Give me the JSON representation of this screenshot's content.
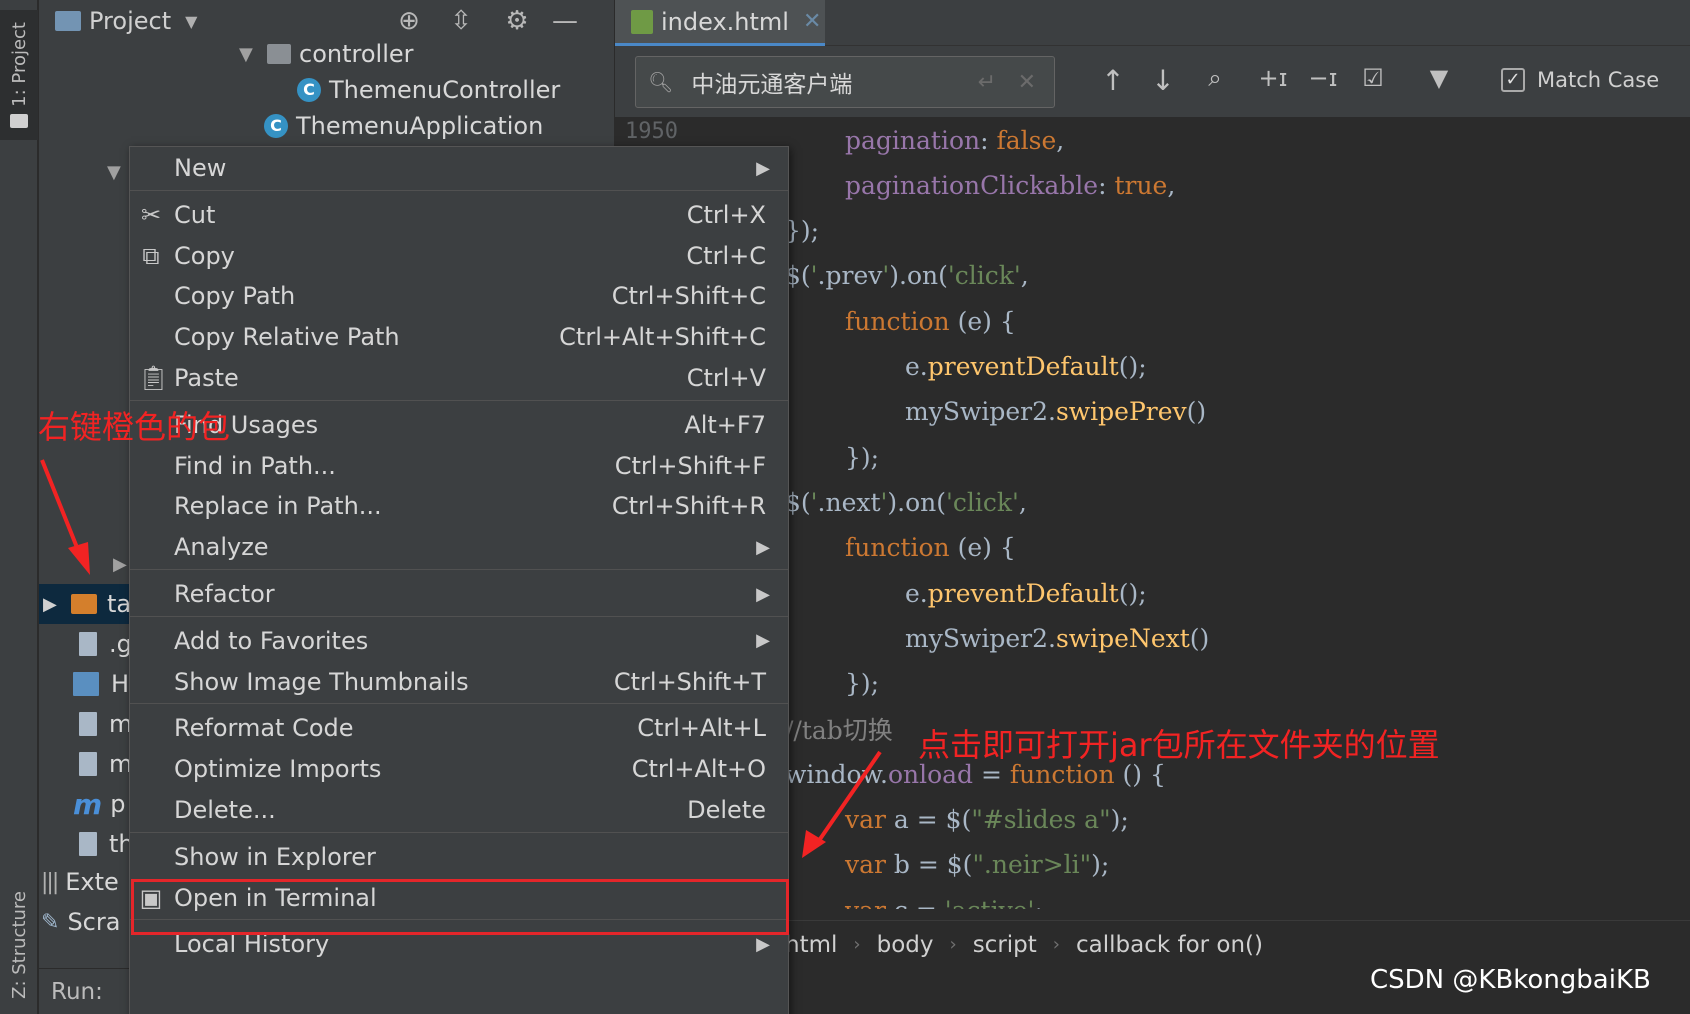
{
  "left_strip": {
    "project_tab": "1: Project",
    "structure_tab": "Z: Structure"
  },
  "project_panel": {
    "title": "Project",
    "tree": {
      "controller": "controller",
      "themenu_controller": "ThemenuController",
      "themenu_application": "ThemenuApplication",
      "selected_folder_fragment": "ta",
      "file_fragments": [
        ".g",
        "H",
        "m",
        "m",
        "p",
        "th"
      ],
      "external_libraries_fragment": "Exte",
      "scratches_fragment": "Scra"
    },
    "icon_names": [
      "locate-icon",
      "collapse-icon",
      "gear-icon",
      "minimize-icon"
    ]
  },
  "run_bar": {
    "label": "Run:"
  },
  "editor": {
    "tab_label": "index.html",
    "find": {
      "query": "中油元通客户端",
      "match_case_label": "Match Case",
      "match_case_checked": true
    },
    "gutter_number": "1950",
    "code_lines": [
      {
        "indent": 2,
        "parts": [
          [
            "t-prop",
            "pagination"
          ],
          [
            "t-plain",
            ": "
          ],
          [
            "t-kw",
            "false"
          ],
          [
            "t-plain",
            ","
          ]
        ]
      },
      {
        "indent": 2,
        "parts": [
          [
            "t-prop",
            "paginationClickable"
          ],
          [
            "t-plain",
            ": "
          ],
          [
            "t-kw",
            "true"
          ],
          [
            "t-plain",
            ","
          ]
        ]
      },
      {
        "indent": 0,
        "parts": [
          [
            "t-plain",
            "});"
          ]
        ]
      },
      {
        "indent": 0,
        "parts": [
          [
            "t-plain",
            "$("
          ],
          [
            "t-str",
            "'"
          ],
          [
            "t-plain",
            ".prev"
          ],
          [
            "t-str",
            "'"
          ],
          [
            "t-plain",
            ").on("
          ],
          [
            "t-str",
            "'click'"
          ],
          [
            "t-plain",
            ","
          ]
        ]
      },
      {
        "indent": 2,
        "parts": [
          [
            "t-kw",
            "function"
          ],
          [
            "t-plain",
            " (e) {"
          ]
        ]
      },
      {
        "indent": 4,
        "parts": [
          [
            "t-plain",
            "e."
          ],
          [
            "t-fn",
            "preventDefault"
          ],
          [
            "t-plain",
            "();"
          ]
        ]
      },
      {
        "indent": 4,
        "parts": [
          [
            "t-plain",
            "mySwiper2."
          ],
          [
            "t-fn",
            "swipePrev"
          ],
          [
            "t-plain",
            "()"
          ]
        ]
      },
      {
        "indent": 2,
        "parts": [
          [
            "t-plain",
            "});"
          ]
        ]
      },
      {
        "indent": 0,
        "parts": [
          [
            "t-plain",
            "$("
          ],
          [
            "t-str",
            "'"
          ],
          [
            "t-plain",
            ".next"
          ],
          [
            "t-str",
            "'"
          ],
          [
            "t-plain",
            ").on("
          ],
          [
            "t-str",
            "'click'"
          ],
          [
            "t-plain",
            ","
          ]
        ]
      },
      {
        "indent": 2,
        "parts": [
          [
            "t-kw",
            "function"
          ],
          [
            "t-plain",
            " (e) {"
          ]
        ]
      },
      {
        "indent": 4,
        "parts": [
          [
            "t-plain",
            "e."
          ],
          [
            "t-fn",
            "preventDefault"
          ],
          [
            "t-plain",
            "();"
          ]
        ]
      },
      {
        "indent": 4,
        "parts": [
          [
            "t-plain",
            "mySwiper2."
          ],
          [
            "t-fn",
            "swipeNext"
          ],
          [
            "t-plain",
            "()"
          ]
        ]
      },
      {
        "indent": 2,
        "parts": [
          [
            "t-plain",
            "});"
          ]
        ]
      },
      {
        "indent": 0,
        "parts": [
          [
            "t-cmt",
            "//tab切换"
          ]
        ]
      },
      {
        "indent": 0,
        "parts": [
          [
            "t-plain",
            "window."
          ],
          [
            "t-prop",
            "onload"
          ],
          [
            "t-plain",
            " = "
          ],
          [
            "t-kw",
            "function"
          ],
          [
            "t-plain",
            " () {"
          ]
        ]
      },
      {
        "indent": 2,
        "parts": [
          [
            "t-kw",
            "var"
          ],
          [
            "t-plain",
            " a = $("
          ],
          [
            "t-str",
            "\"#slides a\""
          ],
          [
            "t-plain",
            ");"
          ]
        ]
      },
      {
        "indent": 2,
        "parts": [
          [
            "t-kw",
            "var"
          ],
          [
            "t-plain",
            " b = $("
          ],
          [
            "t-str",
            "\".neir>li\""
          ],
          [
            "t-plain",
            ");"
          ]
        ]
      },
      {
        "indent": 2,
        "parts": [
          [
            "t-kw",
            "var"
          ],
          [
            "t-plain",
            " c = "
          ],
          [
            "t-str",
            "'active'"
          ],
          [
            "t-plain",
            ";"
          ]
        ]
      }
    ],
    "breadcrumb": [
      "html",
      "body",
      "script",
      "callback for on()"
    ]
  },
  "context_menu": {
    "items": [
      {
        "label": "New",
        "shortcut": "",
        "submenu": true,
        "icon": ""
      },
      {
        "label": "Cut",
        "shortcut": "Ctrl+X",
        "submenu": false,
        "icon": "scissors-icon",
        "sep_before": true
      },
      {
        "label": "Copy",
        "shortcut": "Ctrl+C",
        "submenu": false,
        "icon": "copy-icon"
      },
      {
        "label": "Copy Path",
        "shortcut": "Ctrl+Shift+C",
        "submenu": false,
        "icon": ""
      },
      {
        "label": "Copy Relative Path",
        "shortcut": "Ctrl+Alt+Shift+C",
        "submenu": false,
        "icon": ""
      },
      {
        "label": "Paste",
        "shortcut": "Ctrl+V",
        "submenu": false,
        "icon": "paste-icon"
      },
      {
        "label": "Find Usages",
        "shortcut": "Alt+F7",
        "submenu": false,
        "icon": "",
        "sep_before": true
      },
      {
        "label": "Find in Path...",
        "shortcut": "Ctrl+Shift+F",
        "submenu": false,
        "icon": ""
      },
      {
        "label": "Replace in Path...",
        "shortcut": "Ctrl+Shift+R",
        "submenu": false,
        "icon": ""
      },
      {
        "label": "Analyze",
        "shortcut": "",
        "submenu": true,
        "icon": ""
      },
      {
        "label": "Refactor",
        "shortcut": "",
        "submenu": true,
        "icon": "",
        "sep_before": true
      },
      {
        "label": "Add to Favorites",
        "shortcut": "",
        "submenu": true,
        "icon": "",
        "sep_before": true
      },
      {
        "label": "Show Image Thumbnails",
        "shortcut": "Ctrl+Shift+T",
        "submenu": false,
        "icon": ""
      },
      {
        "label": "Reformat Code",
        "shortcut": "Ctrl+Alt+L",
        "submenu": false,
        "icon": "",
        "sep_before": true
      },
      {
        "label": "Optimize Imports",
        "shortcut": "Ctrl+Alt+O",
        "submenu": false,
        "icon": ""
      },
      {
        "label": "Delete...",
        "shortcut": "Delete",
        "submenu": false,
        "icon": ""
      },
      {
        "label": "Show in Explorer",
        "shortcut": "",
        "submenu": false,
        "icon": "",
        "sep_before": true,
        "highlighted": true
      },
      {
        "label": "Open in Terminal",
        "shortcut": "",
        "submenu": false,
        "icon": "terminal-icon"
      },
      {
        "label": "Local History",
        "shortcut": "",
        "submenu": true,
        "icon": "",
        "sep_before": true
      }
    ]
  },
  "annotations": {
    "right_click_hint": "右键橙色的包",
    "explorer_hint": "点击即可打开jar包所在文件夹的位置",
    "color": "#f22323"
  },
  "watermark": "CSDN @KBkongbaiKB"
}
